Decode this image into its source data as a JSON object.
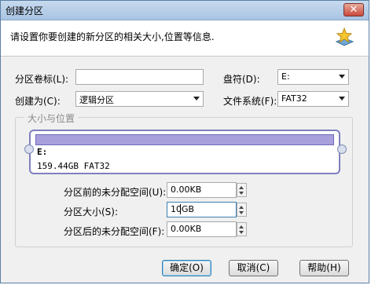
{
  "window": {
    "title": "创建分区"
  },
  "header": {
    "description": "请设置你要创建的新分区的相关大小,位置等信息."
  },
  "form": {
    "label_label": "分区卷标(L):",
    "label_value": "",
    "drive_letter_label": "盘符(D):",
    "drive_letter_value": "E:",
    "create_as_label": "创建为(C):",
    "create_as_value": "逻辑分区",
    "filesystem_label": "文件系统(F):",
    "filesystem_value": "FAT32"
  },
  "size_group": {
    "title": "大小与位置",
    "drive": "E:",
    "info": "159.44GB FAT32",
    "free_before_label": "分区前的未分配空间(U):",
    "free_before_value": "0.00KB",
    "size_label": "分区大小(S):",
    "size_value": "10GB",
    "free_after_label": "分区后的未分配空间(F):",
    "free_after_value": "0.00KB"
  },
  "buttons": {
    "ok": "确定(O)",
    "cancel": "取消(C)",
    "help": "帮助(H)"
  },
  "icons": {
    "close": "close-icon",
    "star": "star-icon"
  }
}
